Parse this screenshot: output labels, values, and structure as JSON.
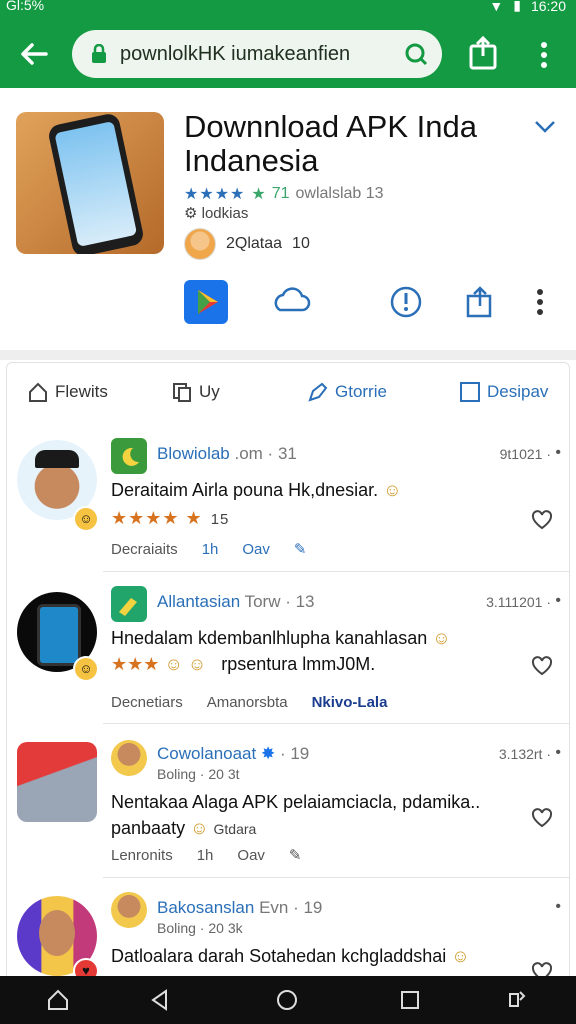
{
  "status": {
    "left": "Gl:5%",
    "time": "16:20"
  },
  "browser": {
    "url": "pownlolkHK iumakeanfien"
  },
  "app": {
    "title": "Downnload APK Inda Indanesia",
    "rating_text": "71",
    "rating_label": "owlalslab 13",
    "sub_label": "lodkias",
    "dev_name": "2Qlataa",
    "dev_count": "10"
  },
  "tabs": [
    {
      "label": "Flewits",
      "icon": "home-icon"
    },
    {
      "label": "Uy",
      "icon": "copy-icon"
    },
    {
      "label": "Gtorrie",
      "icon": "pencil-icon"
    },
    {
      "label": "Desipav",
      "icon": "square-icon"
    }
  ],
  "posts": [
    {
      "name": "Blowiolab",
      "meta": ".om · 31",
      "time": "9t1021 ·",
      "text": "Deraitaim Airla pouna Hk,dnesiar.",
      "stars": "★★★★  ★",
      "star_count": "15",
      "foot": [
        "Decraiaits",
        "1h",
        "Oav"
      ]
    },
    {
      "name": "Allantasian",
      "meta": "Torw · 13",
      "time": "3.111201 ·",
      "text_line1": "Hnedalam kdembanlhlupha kanahlasan",
      "text_line2": "rpsentura lmmJ0M.",
      "stars": "★★★",
      "foot": [
        "Decnetiars",
        "Amanorsbta",
        "Nkivo-Lala"
      ]
    },
    {
      "name": "Cowolanoaat",
      "meta": "· 19",
      "sub": "Boling · 20 3t",
      "time": "3.132rt ·",
      "text_line1": "Nentakaa Alaga APK pelaiamciacla, pdamika..",
      "text_line2": "panbaaty",
      "text_tail": "Gtdara",
      "foot": [
        "Lenronits",
        "1h",
        "Oav"
      ]
    },
    {
      "name": "Bakosanslan",
      "meta": "Evn · 19",
      "sub": "Boling · 20 3k",
      "text_line1": "Datloalara darah Sotahedan kchgladdshai"
    }
  ]
}
